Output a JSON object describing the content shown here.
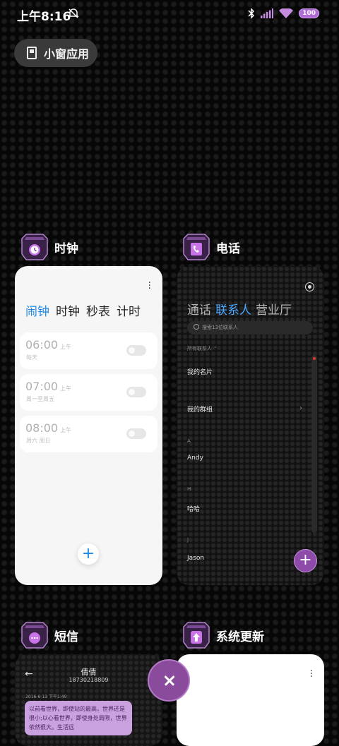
{
  "status_bar": {
    "time": "上午8:16",
    "battery": "100",
    "icons": [
      "mute-icon",
      "bluetooth-icon",
      "signal-icon",
      "wifi-icon",
      "battery-icon"
    ]
  },
  "small_window_button": {
    "label": "小窗应用"
  },
  "apps": {
    "clock": {
      "title": "时钟",
      "tabs": [
        "闹钟",
        "时钟",
        "秒表",
        "计时"
      ],
      "active_tab": "闹钟",
      "alarms": [
        {
          "time": "06:00",
          "ampm": "上午",
          "repeat": "每天",
          "enabled": false
        },
        {
          "time": "07:00",
          "ampm": "上午",
          "repeat": "周一至周五",
          "enabled": false
        },
        {
          "time": "08:00",
          "ampm": "上午",
          "repeat": "周六 周日",
          "enabled": false
        }
      ],
      "add_label": "+"
    },
    "phone": {
      "title": "电话",
      "tabs": [
        "通话",
        "联系人",
        "营业厅"
      ],
      "active_tab": "联系人",
      "search_placeholder": "搜索13位联系人",
      "all_contacts_label": "所有联系人",
      "my_card": "我的名片",
      "my_groups": "我的群组",
      "letters": [
        "A",
        "H",
        "J"
      ],
      "contacts": [
        "Andy",
        "哈哈",
        "Jason"
      ],
      "add_label": "+"
    },
    "sms": {
      "title": "短信",
      "contact_name": "倩倩",
      "contact_number": "18730218809",
      "date": "2016-6-13 下午1:49",
      "message": "以前看世界，即使站的最高，世界还是很小;以心看世界，即使身处局限，世界依然很大。生活远"
    },
    "update": {
      "title": "系统更新"
    }
  },
  "colors": {
    "accent_blue": "#1e88e5",
    "purple": "#8a4b9c",
    "background": "#070707"
  }
}
